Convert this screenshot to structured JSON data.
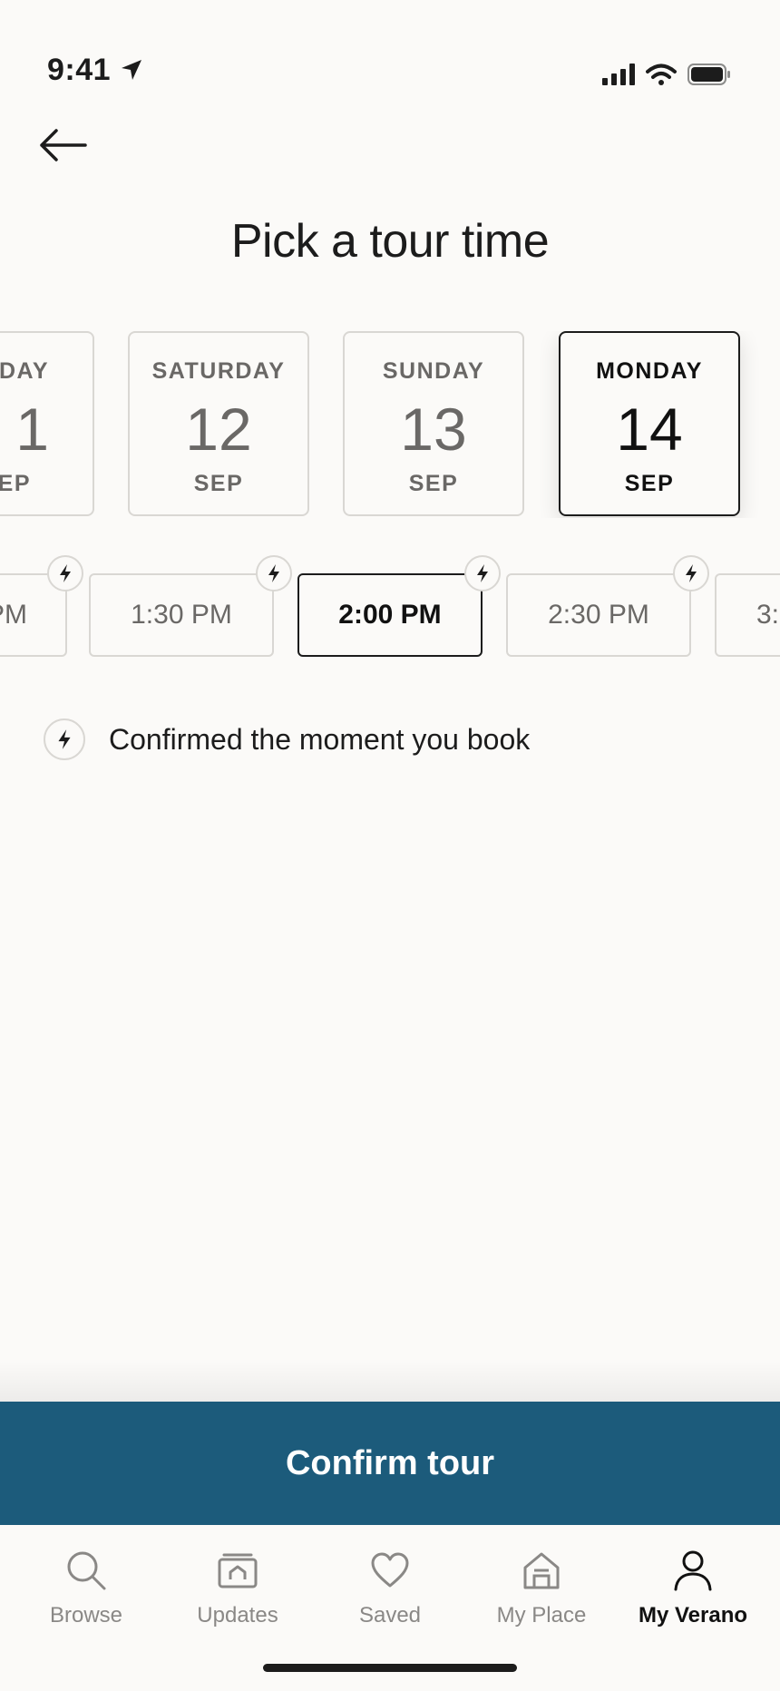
{
  "status_bar": {
    "time": "9:41"
  },
  "header": {
    "title": "Pick a tour time"
  },
  "dates": [
    {
      "dow": "DAY",
      "day": "1",
      "month": "EP",
      "selected": false
    },
    {
      "dow": "SATURDAY",
      "day": "12",
      "month": "SEP",
      "selected": false
    },
    {
      "dow": "SUNDAY",
      "day": "13",
      "month": "SEP",
      "selected": false
    },
    {
      "dow": "MONDAY",
      "day": "14",
      "month": "SEP",
      "selected": true
    }
  ],
  "times": [
    {
      "label": "PM",
      "selected": false
    },
    {
      "label": "1:30 PM",
      "selected": false
    },
    {
      "label": "2:00 PM",
      "selected": true
    },
    {
      "label": "2:30 PM",
      "selected": false
    },
    {
      "label": "3:",
      "selected": false
    }
  ],
  "info": {
    "text": "Confirmed the moment you book"
  },
  "confirm": {
    "label": "Confirm tour",
    "color": "#1c5b7b"
  },
  "tabs": [
    {
      "label": "Browse",
      "icon": "search-icon",
      "active": false
    },
    {
      "label": "Updates",
      "icon": "updates-icon",
      "active": false
    },
    {
      "label": "Saved",
      "icon": "heart-icon",
      "active": false
    },
    {
      "label": "My Place",
      "icon": "home-icon",
      "active": false
    },
    {
      "label": "My Verano",
      "icon": "person-icon",
      "active": true
    }
  ]
}
